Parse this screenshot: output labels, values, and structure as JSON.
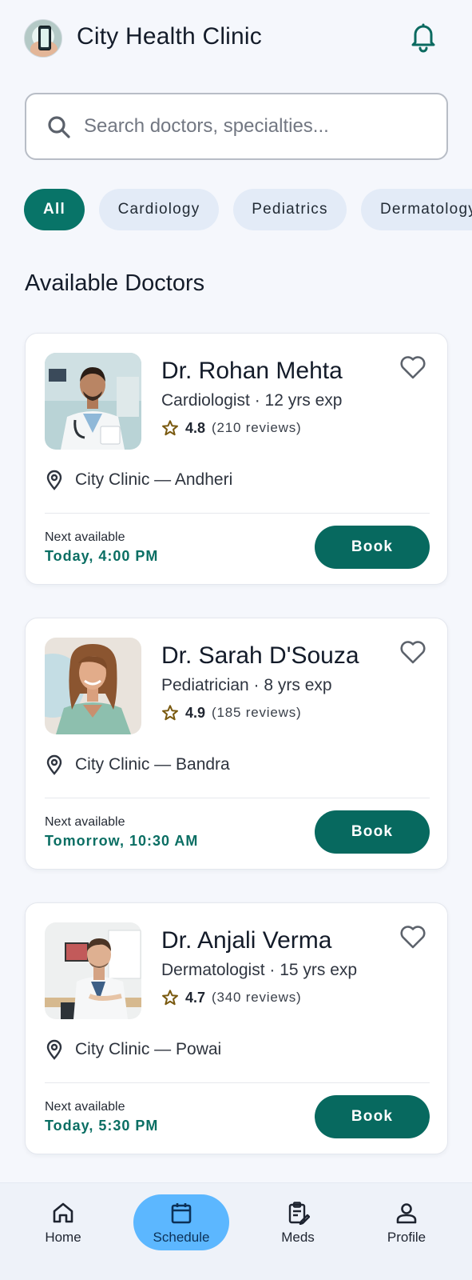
{
  "header": {
    "app_title": "City Health Clinic",
    "logo_icon": "clinic-app-logo",
    "notification_icon": "bell-icon"
  },
  "search": {
    "placeholder": "Search doctors, specialties...",
    "icon": "search-icon"
  },
  "filters": [
    {
      "label": "All",
      "active": true
    },
    {
      "label": "Cardiology",
      "active": false
    },
    {
      "label": "Pediatrics",
      "active": false
    },
    {
      "label": "Dermatology",
      "active": false
    }
  ],
  "section_title": "Available Doctors",
  "doctors": [
    {
      "name": "Dr. Rohan Mehta",
      "meta": "Cardiologist · 12 yrs exp",
      "rating": "4.8",
      "reviews": "(210 reviews)",
      "location": "City Clinic — Andheri",
      "next_label": "Next available",
      "next_time": "Today, 4:00 PM",
      "book_label": "Book"
    },
    {
      "name": "Dr. Sarah D'Souza",
      "meta": "Pediatrician · 8 yrs exp",
      "rating": "4.9",
      "reviews": "(185 reviews)",
      "location": "City Clinic — Bandra",
      "next_label": "Next available",
      "next_time": "Tomorrow, 10:30 AM",
      "book_label": "Book"
    },
    {
      "name": "Dr. Anjali Verma",
      "meta": "Dermatologist · 15 yrs exp",
      "rating": "4.7",
      "reviews": "(340 reviews)",
      "location": "City Clinic — Powai",
      "next_label": "Next available",
      "next_time": "Today, 5:30 PM",
      "book_label": "Book"
    }
  ],
  "bottom_nav": [
    {
      "label": "Home",
      "icon": "home-icon",
      "active": false
    },
    {
      "label": "Schedule",
      "icon": "calendar-icon",
      "active": true
    },
    {
      "label": "Meds",
      "icon": "clipboard-icon",
      "active": false
    },
    {
      "label": "Profile",
      "icon": "profile-icon",
      "active": false
    }
  ],
  "colors": {
    "primary": "#087468",
    "chip_inactive": "#e3ebf7",
    "nav_active": "#5cb7ff",
    "background": "#f5f7fc",
    "star": "#7a5a10"
  }
}
